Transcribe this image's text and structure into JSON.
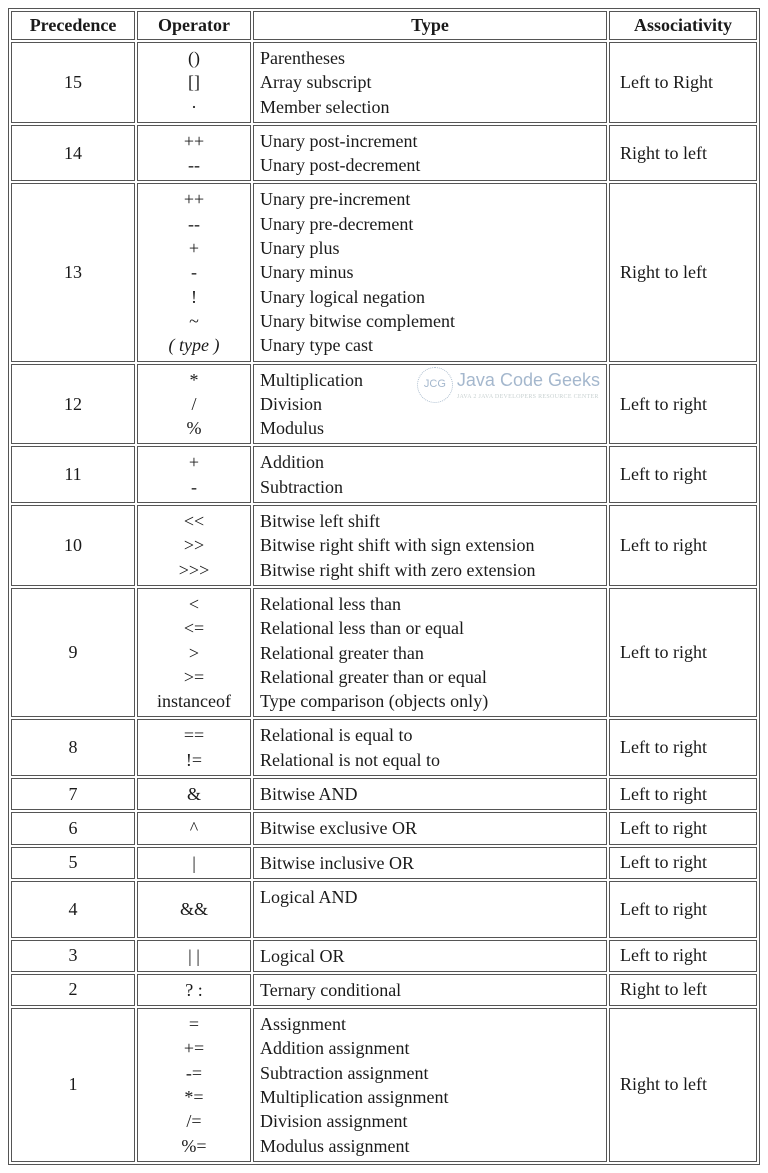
{
  "headers": {
    "precedence": "Precedence",
    "operator": "Operator",
    "type": "Type",
    "associativity": "Associativity"
  },
  "watermark": {
    "logo": "JCG",
    "text": "Java Code Geeks",
    "sub": "JAVA 2 JAVA DEVELOPERS RESOURCE CENTER"
  },
  "rows": [
    {
      "precedence": "15",
      "operators": [
        "()",
        "[]",
        "·"
      ],
      "types": [
        "Parentheses",
        "Array subscript",
        "Member selection"
      ],
      "associativity": "Left to Right"
    },
    {
      "precedence": "14",
      "operators": [
        "++",
        "--"
      ],
      "types": [
        "Unary post-increment",
        "Unary post-decrement"
      ],
      "associativity": "Right to left"
    },
    {
      "precedence": "13",
      "operators": [
        "++",
        "--",
        "+",
        "-",
        "!",
        "~",
        "( type )"
      ],
      "operator_italic_idx": 6,
      "types": [
        "Unary pre-increment",
        "Unary pre-decrement",
        "Unary plus",
        "Unary minus",
        "Unary logical negation",
        "Unary bitwise complement",
        "Unary type cast"
      ],
      "associativity": "Right to left"
    },
    {
      "precedence": "12",
      "operators": [
        "*",
        "/",
        "%"
      ],
      "types": [
        "Multiplication",
        "Division",
        "Modulus"
      ],
      "associativity": "Left to right",
      "watermark": true
    },
    {
      "precedence": "11",
      "operators": [
        "+",
        "-"
      ],
      "types": [
        "Addition",
        "Subtraction"
      ],
      "associativity": "Left to right"
    },
    {
      "precedence": "10",
      "operators": [
        "<<",
        ">>",
        ">>>"
      ],
      "types": [
        "Bitwise left shift",
        "Bitwise right shift with sign extension",
        "Bitwise right shift with zero extension"
      ],
      "associativity": "Left to right"
    },
    {
      "precedence": "9",
      "operators": [
        "<",
        "<=",
        ">",
        ">=",
        "instanceof"
      ],
      "types": [
        "Relational less than",
        "Relational less than or equal",
        "Relational greater than",
        "Relational greater than or equal",
        "Type comparison (objects only)"
      ],
      "associativity": "Left to right"
    },
    {
      "precedence": "8",
      "operators": [
        "==",
        "!="
      ],
      "types": [
        "Relational is equal to",
        "Relational is not equal to"
      ],
      "associativity": "Left to right"
    },
    {
      "precedence": "7",
      "operators": [
        "&"
      ],
      "types": [
        "Bitwise AND"
      ],
      "associativity": "Left to right"
    },
    {
      "precedence": "6",
      "operators": [
        "^"
      ],
      "types": [
        "Bitwise exclusive OR"
      ],
      "associativity": "Left to right"
    },
    {
      "precedence": "5",
      "operators": [
        "|"
      ],
      "types": [
        "Bitwise inclusive OR"
      ],
      "associativity": "Left to right"
    },
    {
      "precedence": "4",
      "operators": [
        "&&"
      ],
      "types": [
        "Logical AND",
        ""
      ],
      "associativity": "Left to right"
    },
    {
      "precedence": "3",
      "operators": [
        "| |"
      ],
      "types": [
        "Logical OR"
      ],
      "associativity": "Left to right"
    },
    {
      "precedence": "2",
      "operators": [
        "? :"
      ],
      "types": [
        "Ternary conditional"
      ],
      "associativity": "Right to left"
    },
    {
      "precedence": "1",
      "operators": [
        "=",
        "+=",
        "-=",
        "*=",
        "/=",
        "%="
      ],
      "types": [
        "Assignment",
        "Addition assignment",
        "Subtraction assignment",
        "Multiplication assignment",
        "Division assignment",
        "Modulus assignment"
      ],
      "associativity": "Right to left"
    }
  ]
}
